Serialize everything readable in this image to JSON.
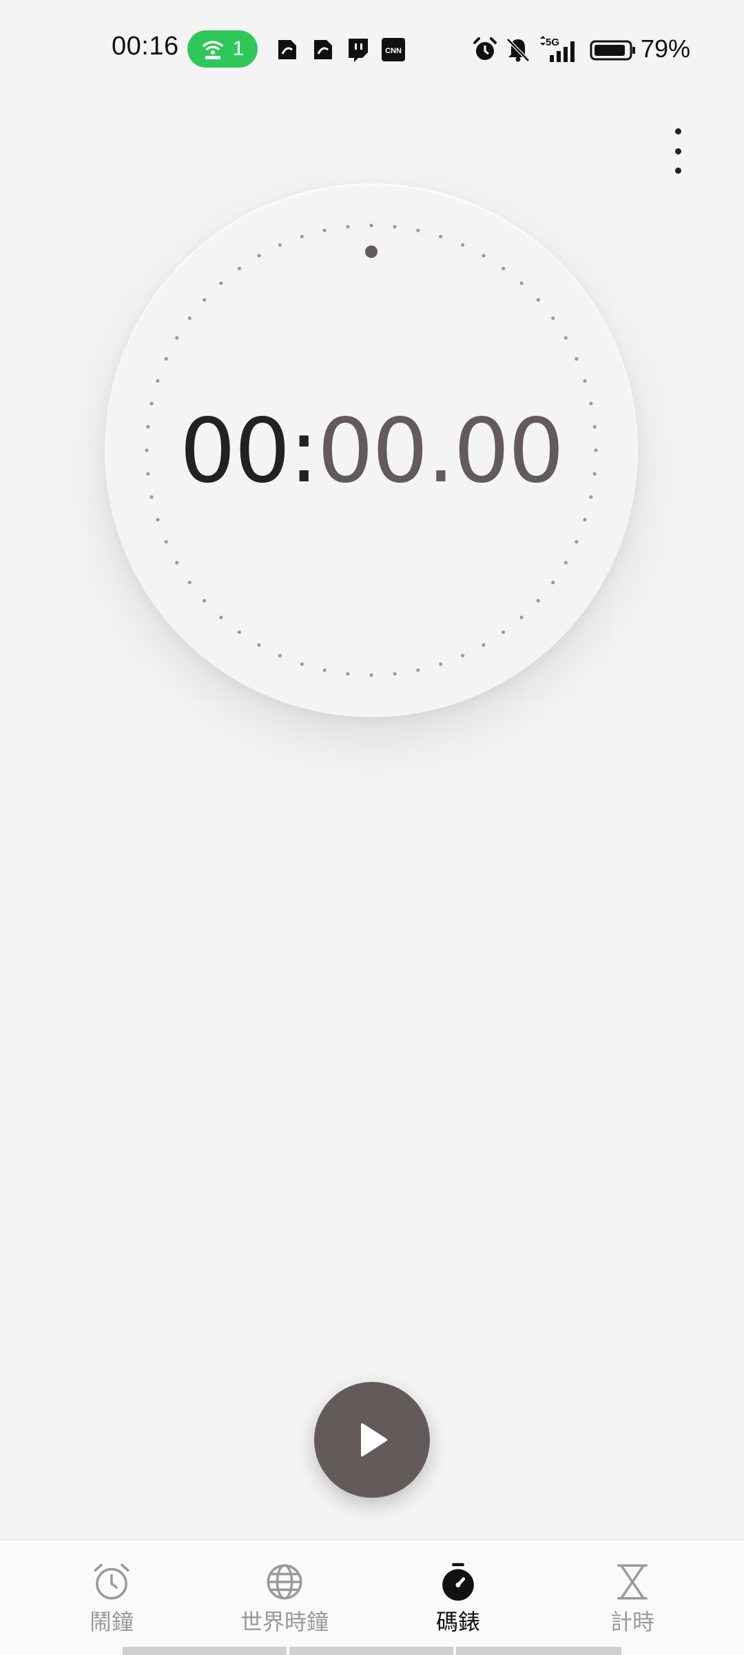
{
  "status_bar": {
    "time": "00:16",
    "hotspot_count": "1",
    "battery_percent": "79%",
    "network": "5G"
  },
  "stopwatch": {
    "minutes": "00:",
    "seconds_and_hundredths": "00.00"
  },
  "controls": {
    "primary_action": "start"
  },
  "bottom_nav": {
    "tabs": [
      {
        "label": "鬧鐘",
        "icon": "alarm-clock-icon",
        "active": false
      },
      {
        "label": "世界時鐘",
        "icon": "globe-icon",
        "active": false
      },
      {
        "label": "碼錶",
        "icon": "stopwatch-icon",
        "active": true
      },
      {
        "label": "計時",
        "icon": "hourglass-icon",
        "active": false
      }
    ]
  },
  "colors": {
    "background": "#f4f4f4",
    "hotspot_green": "#2fc75a",
    "accent_gray": "#625b5a",
    "inactive_label": "#9a9a9a"
  }
}
